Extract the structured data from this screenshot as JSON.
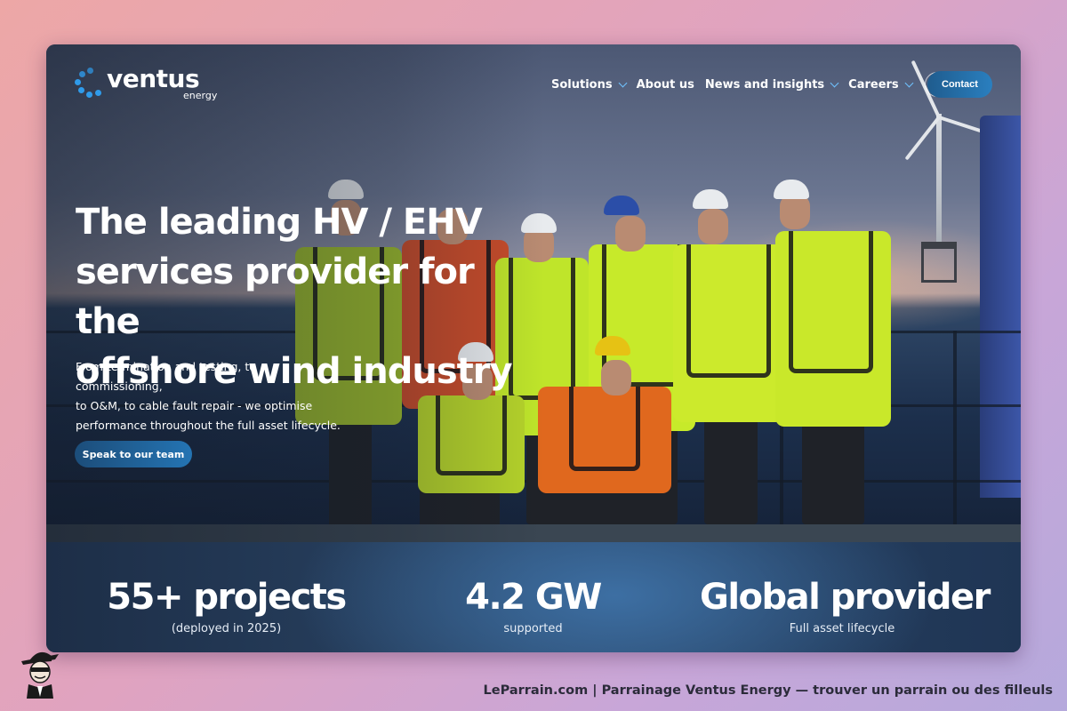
{
  "brand": {
    "name": "ventus",
    "sub": "energy"
  },
  "nav": {
    "items": [
      {
        "label": "Solutions",
        "dropdown": true
      },
      {
        "label": "About us",
        "dropdown": false
      },
      {
        "label": "News and insights",
        "dropdown": true
      },
      {
        "label": "Careers",
        "dropdown": true
      }
    ],
    "language_icon": "globe-icon",
    "contact_label": "Contact"
  },
  "hero": {
    "headline_lines": [
      "The leading HV / EHV",
      "services provider for the",
      "offshore wind industry"
    ],
    "subtext_lines": [
      "From termination and testing, to commissioning,",
      "to O&M, to cable fault repair - we optimise",
      "performance throughout the full asset lifecycle."
    ],
    "cta_label": "Speak to our team"
  },
  "stats": [
    {
      "value": "55+ projects",
      "label": "(deployed in 2025)"
    },
    {
      "value": "4.2 GW",
      "label": "supported"
    },
    {
      "value": "Global provider",
      "label": "Full asset lifecycle"
    }
  ],
  "caption": "LeParrain.com | Parrainage Ventus Energy — trouver un parrain ou des filleuls",
  "colors": {
    "accent": "#2a7fbf",
    "logo_dots": "#2f9bea",
    "chevron": "#6fc2ff",
    "stats_bg": "#243349"
  }
}
